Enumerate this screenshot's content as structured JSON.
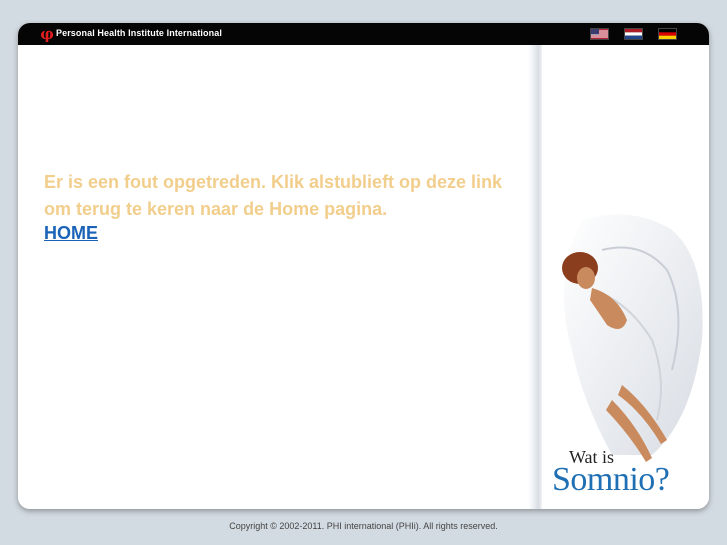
{
  "header": {
    "logo_glyph": "φ",
    "brand": "Personal Health Institute International",
    "flags": [
      "english-flag",
      "dutch-flag",
      "german-flag"
    ]
  },
  "main": {
    "error_message": "Er is een fout opgetreden. Klik alstublieft op deze link om terug te keren naar de Home pagina.",
    "home_link": "HOME"
  },
  "sidebar": {
    "promo_line1": "Wat is",
    "promo_line2": "Somnio?"
  },
  "footer": {
    "copyright": "Copyright © 2002-2011. PHI international (PHIi). All rights reserved."
  },
  "colors": {
    "accent": "#e31e1e",
    "message": "#f2ce8c",
    "link": "#1b63b8",
    "promo": "#1f6fb4"
  }
}
